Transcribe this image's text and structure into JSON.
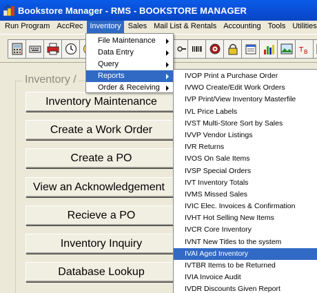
{
  "window": {
    "title": "Bookstore Manager - RMS - BOOKSTORE MANAGER",
    "icon": "bookstore-app-icon"
  },
  "menubar": [
    {
      "label": "Run Program"
    },
    {
      "label": "AccRec"
    },
    {
      "label": "Inventory"
    },
    {
      "label": "Sales"
    },
    {
      "label": "Mail List & Rentals"
    },
    {
      "label": "Accounting"
    },
    {
      "label": "Tools"
    },
    {
      "label": "Utilities"
    }
  ],
  "toolbar_icons": [
    "calculator-icon",
    "keyboard-icon",
    "printer-icon",
    "clock-icon",
    "smiley-icon",
    "tool-icon",
    "barcode-icon",
    "target-icon",
    "lock-icon",
    "form-icon",
    "bar-chart-icon",
    "picture-icon",
    "text-icon",
    "window-icon"
  ],
  "group": {
    "title": "Inventory /",
    "buttons": [
      {
        "label": "Inventory Maintenance"
      },
      {
        "label": "Create a Work Order"
      },
      {
        "label": "Create a PO"
      },
      {
        "label": "View an Acknowledgement"
      },
      {
        "label": "Recieve a PO"
      },
      {
        "label": "Inventory Inquiry"
      },
      {
        "label": "Database Lookup"
      }
    ]
  },
  "inventory_menu": [
    {
      "label": "File Maintenance",
      "submenu": true
    },
    {
      "label": "Data Entry",
      "submenu": true
    },
    {
      "label": "Query",
      "submenu": true
    },
    {
      "label": "Reports",
      "submenu": true,
      "selected": true
    },
    {
      "label": "Order & Receiving",
      "submenu": true
    }
  ],
  "reports_menu": [
    {
      "label": "IVOP Print a Purchase Order"
    },
    {
      "label": "IVWO Create/Edit Work Orders"
    },
    {
      "label": "IVP  Print/View Inventory Masterfile"
    },
    {
      "label": "IVL  Price Labels"
    },
    {
      "label": "IVST Multi-Store Sort by Sales"
    },
    {
      "label": "IVVP Vendor Listings"
    },
    {
      "label": "IVR  Returns"
    },
    {
      "label": "IVOS On Sale Items"
    },
    {
      "label": "IVSP Special Orders"
    },
    {
      "label": "IVT  Inventory Totals"
    },
    {
      "label": "IVMS Missed Sales"
    },
    {
      "label": "IVIC Elec. Invoices & Confirmation"
    },
    {
      "label": "IVHT Hot Selling New Items"
    },
    {
      "label": "IVCR Core Inventory"
    },
    {
      "label": "IVNT New Titles to the system"
    },
    {
      "label": "IVAI Aged Inventory",
      "selected": true
    },
    {
      "label": "IVTBR Items to be Returned"
    },
    {
      "label": "IVIA Invoice Audit"
    },
    {
      "label": "IVDR Discounts Given Report"
    }
  ],
  "colors": {
    "titlebar": "#0a4fd8",
    "selection": "#316ac5",
    "face": "#ece9d8"
  }
}
